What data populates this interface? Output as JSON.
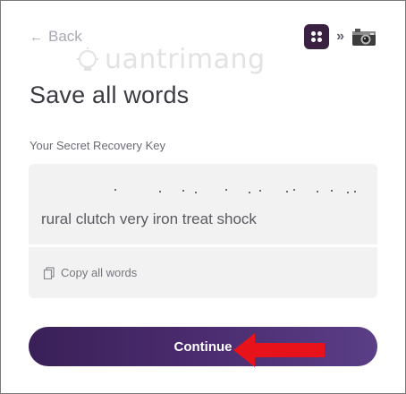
{
  "header": {
    "back_label": "Back",
    "app_icon": "dice-app-icon",
    "separator_icon": "double-chevron-right-icon",
    "device_icon": "camera-icon"
  },
  "watermark": {
    "text": "uantrimang"
  },
  "main": {
    "title": "Save all words",
    "key_label": "Your Secret Recovery Key",
    "words_partial": "rural clutch very iron treat shock",
    "copy_label": "Copy all words",
    "continue_label": "Continue"
  },
  "annotation": {
    "arrow_color": "#e8121b"
  },
  "colors": {
    "accent": "#3a2057",
    "accent_end": "#5a3e86",
    "panel": "#f2f2f3"
  }
}
